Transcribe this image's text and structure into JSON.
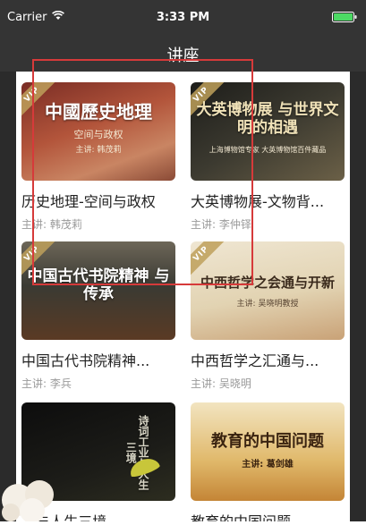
{
  "status_bar": {
    "carrier": "Carrier",
    "time": "3:33 PM"
  },
  "nav": {
    "title": "讲座"
  },
  "courses": [
    {
      "title": "历史地理-空间与政权",
      "speaker": "主讲: 韩茂莉",
      "thumb_title": "中國歷史地理",
      "thumb_sub": "空间与政权",
      "thumb_speaker": "主讲: 韩茂莉",
      "vip": "VIP"
    },
    {
      "title": "大英博物展-文物背...",
      "speaker": "主讲: 李仲铎",
      "thumb_title": "大英博物展 与世界文明的相遇",
      "thumb_sub": "上海博物馆专家 大英博物馆百件藏品",
      "vip": "VIP"
    },
    {
      "title": "中国古代书院精神...",
      "speaker": "主讲: 李兵",
      "thumb_title": "中国古代书院精神 与传承",
      "vip": "VIP"
    },
    {
      "title": "中西哲学之汇通与...",
      "speaker": "主讲: 吴晓明",
      "thumb_title": "中西哲学之会通与开新",
      "thumb_sub": "主讲: 吴晓明教授",
      "vip": "VIP"
    },
    {
      "title": "...与人生三境",
      "thumb_title": "诗词工业与人生三境"
    },
    {
      "title": "教育的中国问题",
      "thumb_title": "教育的中国问题",
      "thumb_sub": "主讲: 葛剑雄"
    }
  ],
  "colors": {
    "bar_bg": "#343434",
    "overlay_red": "#d63a3a"
  }
}
